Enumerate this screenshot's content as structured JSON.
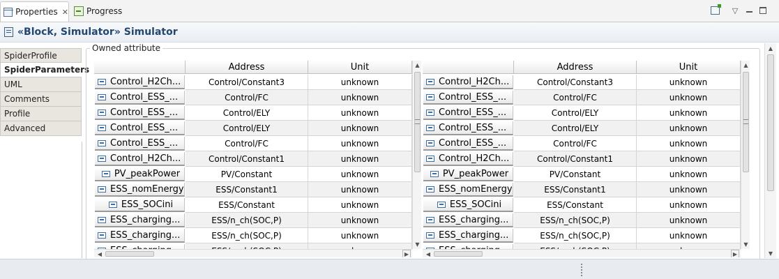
{
  "tabs": [
    {
      "label": "Properties",
      "icon": "properties-icon",
      "active": true
    },
    {
      "label": "Progress",
      "icon": "progress-icon",
      "active": false
    }
  ],
  "toolbar": {
    "pin_icon": "pin-view-icon",
    "menu_icon": "view-menu-icon",
    "minimize_icon": "minimize-icon",
    "maximize_icon": "maximize-icon"
  },
  "title": {
    "text": "«Block, Simulator» Simulator",
    "icon": "block-icon"
  },
  "property_tabs": [
    {
      "label": "SpiderProfile",
      "active": false
    },
    {
      "label": "SpiderParameters",
      "active": true
    },
    {
      "label": "UML",
      "active": false
    },
    {
      "label": "Comments",
      "active": false
    },
    {
      "label": "Profile",
      "active": false
    },
    {
      "label": "Advanced",
      "active": false
    }
  ],
  "group_label": "Owned attribute",
  "columns": {
    "name": "",
    "address": "Address",
    "unit": "Unit"
  },
  "left_rows": [
    {
      "name": "Control_H2Ch...",
      "address": "Control/Constant3",
      "unit": "unknown",
      "center": false
    },
    {
      "name": "Control_ESS_...",
      "address": "Control/FC",
      "unit": "unknown",
      "center": false
    },
    {
      "name": "Control_ESS_...",
      "address": "Control/ELY",
      "unit": "unknown",
      "center": false
    },
    {
      "name": "Control_ESS_...",
      "address": "Control/ELY",
      "unit": "unknown",
      "center": false
    },
    {
      "name": "Control_ESS_...",
      "address": "Control/FC",
      "unit": "unknown",
      "center": false
    },
    {
      "name": "Control_H2Ch...",
      "address": "Control/Constant1",
      "unit": "unknown",
      "center": false
    },
    {
      "name": "PV_peakPower",
      "address": "PV/Constant",
      "unit": "unknown",
      "center": true
    },
    {
      "name": "ESS_nomEnergy",
      "address": "ESS/Constant1",
      "unit": "unknown",
      "center": false
    },
    {
      "name": "ESS_SOCini",
      "address": "ESS/Constant",
      "unit": "unknown",
      "center": true
    },
    {
      "name": "ESS_charging...",
      "address": "ESS/n_ch(SOC,P)",
      "unit": "unknown",
      "center": false
    },
    {
      "name": "ESS_charging...",
      "address": "ESS/n_ch(SOC,P)",
      "unit": "unknown",
      "center": false
    },
    {
      "name": "ESS_charging...",
      "address": "ESS/n_ch(SOC,P)",
      "unit": "unknown",
      "center": false
    }
  ],
  "right_rows": [
    {
      "name": "Control_H2Ch...",
      "address": "Control/Constant3",
      "unit": "unknown",
      "center": false
    },
    {
      "name": "Control_ESS_...",
      "address": "Control/FC",
      "unit": "unknown",
      "center": false
    },
    {
      "name": "Control_ESS_...",
      "address": "Control/ELY",
      "unit": "unknown",
      "center": false
    },
    {
      "name": "Control_ESS_...",
      "address": "Control/ELY",
      "unit": "unknown",
      "center": false
    },
    {
      "name": "Control_ESS_...",
      "address": "Control/FC",
      "unit": "unknown",
      "center": false
    },
    {
      "name": "Control_H2Ch...",
      "address": "Control/Constant1",
      "unit": "unknown",
      "center": false
    },
    {
      "name": "PV_peakPower",
      "address": "PV/Constant",
      "unit": "unknown",
      "center": true
    },
    {
      "name": "ESS_nomEnergy",
      "address": "ESS/Constant1",
      "unit": "unknown",
      "center": false
    },
    {
      "name": "ESS_SOCini",
      "address": "ESS/Constant",
      "unit": "unknown",
      "center": true
    },
    {
      "name": "ESS_charging...",
      "address": "ESS/n_ch(SOC,P)",
      "unit": "unknown",
      "center": false
    },
    {
      "name": "ESS_charging...",
      "address": "ESS/n_ch(SOC,P)",
      "unit": "unknown",
      "center": false
    },
    {
      "name": "ESS_charging...",
      "address": "ESS/n_ch(SOC,P)",
      "unit": "unknown",
      "center": false
    }
  ]
}
